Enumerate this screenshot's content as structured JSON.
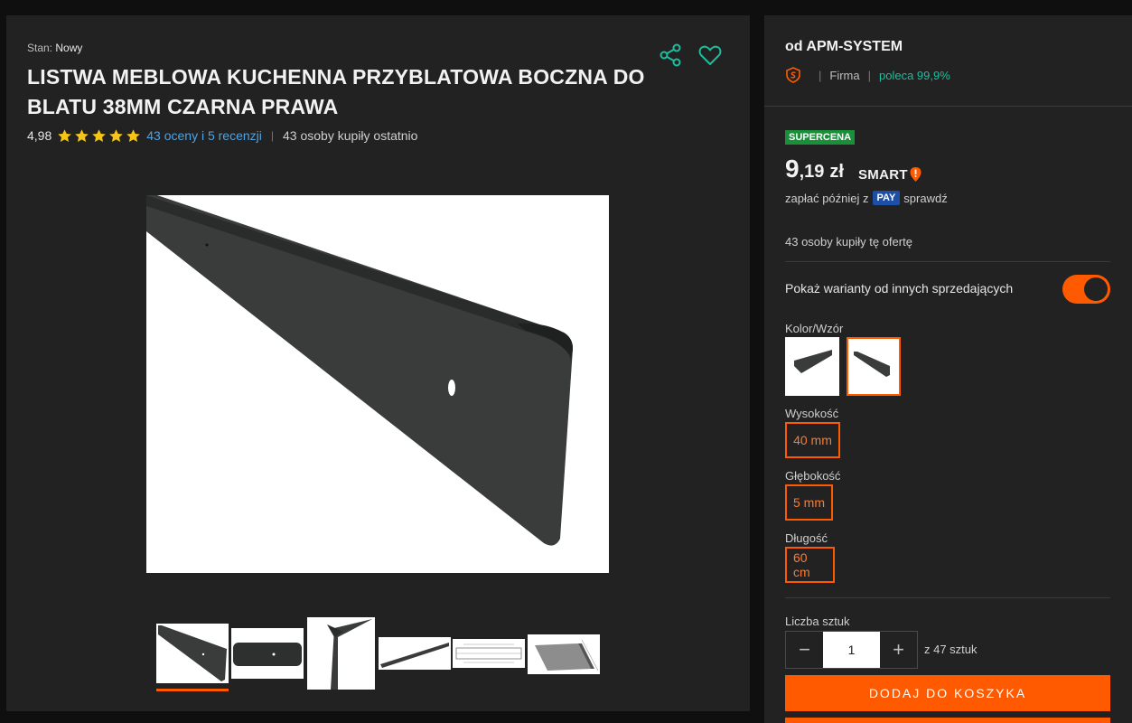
{
  "product": {
    "condition_label": "Stan:",
    "condition_value": "Nowy",
    "title": "LISTWA MEBLOWA KUCHENNA PRZYBLATOWA BOCZNA DO BLATU 38MM CZARNA PRAWA",
    "rating": "4,98",
    "stars": 5,
    "reviews_link": "43 oceny i 5 recenzji",
    "separator": "|",
    "bought_recently": "43 osoby kupiły ostatnio",
    "thumbnail_count": 6,
    "active_thumbnail": 1
  },
  "seller": {
    "name": "od APM-SYSTEM",
    "type": "Firma",
    "recommend": "poleca 99,9%"
  },
  "offer": {
    "badge": "SUPERCENA",
    "price_main": "9",
    "price_fraction": ",19",
    "currency": "zł",
    "smart_label": "SMART",
    "pay_later_prefix": "zapłać później z",
    "pay_label": "PAY",
    "pay_later_link": "sprawdź",
    "buyers": "43 osoby kupiły tę ofertę"
  },
  "variants": {
    "toggle_label": "Pokaż warianty od innych sprzedających",
    "toggle_on": true,
    "color_label": "Kolor/Wzór",
    "height_label": "Wysokość",
    "height_value": "40 mm",
    "depth_label": "Głębokość",
    "depth_value": "5 mm",
    "length_label": "Długość",
    "length_value": "60 cm"
  },
  "quantity": {
    "label": "Liczba sztuk",
    "value": "1",
    "minus": "−",
    "plus": "+",
    "max": "z 47 sztuk"
  },
  "actions": {
    "add_to_cart": "DODAJ DO KOSZYKA"
  },
  "colors": {
    "accent": "#ff5a00",
    "link": "#4fa3e0",
    "recommend": "#1bbf9d",
    "badge": "#1a8f3a",
    "star": "#f5c518",
    "pay_blue": "#1d4fa6"
  }
}
